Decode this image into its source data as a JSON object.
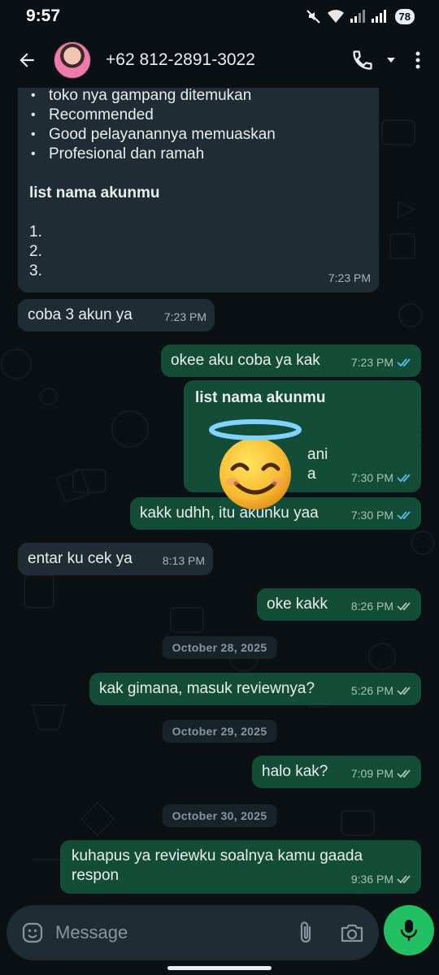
{
  "statusbar": {
    "time": "9:57",
    "battery": "78"
  },
  "header": {
    "contact": "+62 812-2891-3022"
  },
  "messages": {
    "m1": {
      "bullets": [
        "toko nya gampang ditemukan",
        "Recommended",
        "Good pelayanannya memuaskan",
        "Profesional dan ramah"
      ],
      "heading": "list nama akunmu",
      "items": [
        "1.",
        "2.",
        "3."
      ],
      "time": "7:23 PM"
    },
    "m2": {
      "text": "coba 3 akun ya",
      "time": "7:23 PM"
    },
    "m3": {
      "text": "okee aku coba ya kak",
      "time": "7:23 PM"
    },
    "m4": {
      "heading": "list nama akunmu",
      "frag1": "ani",
      "frag2": "a",
      "time": "7:30 PM"
    },
    "m5": {
      "text": "kakk udhh, itu akunku yaa",
      "time": "7:30 PM"
    },
    "m6": {
      "text": "entar ku cek ya",
      "time": "8:13 PM"
    },
    "m7": {
      "text": "oke kakk",
      "time": "8:26 PM"
    },
    "d1": "October 28, 2025",
    "m8": {
      "text": "kak gimana, masuk reviewnya?",
      "time": "5:26 PM"
    },
    "d2": "October 29, 2025",
    "m9": {
      "text": "halo kak?",
      "time": "7:09 PM"
    },
    "d3": "October 30, 2025",
    "m10": {
      "line1": "kuhapus ya reviewku soalnya kamu gaada",
      "line2": "respon",
      "time": "9:36 PM"
    }
  },
  "composer": {
    "placeholder": "Message"
  },
  "colors": {
    "incoming": "#202c33",
    "outgoing": "#144d37",
    "read_tick": "#53bdeb",
    "accent": "#21c063"
  }
}
